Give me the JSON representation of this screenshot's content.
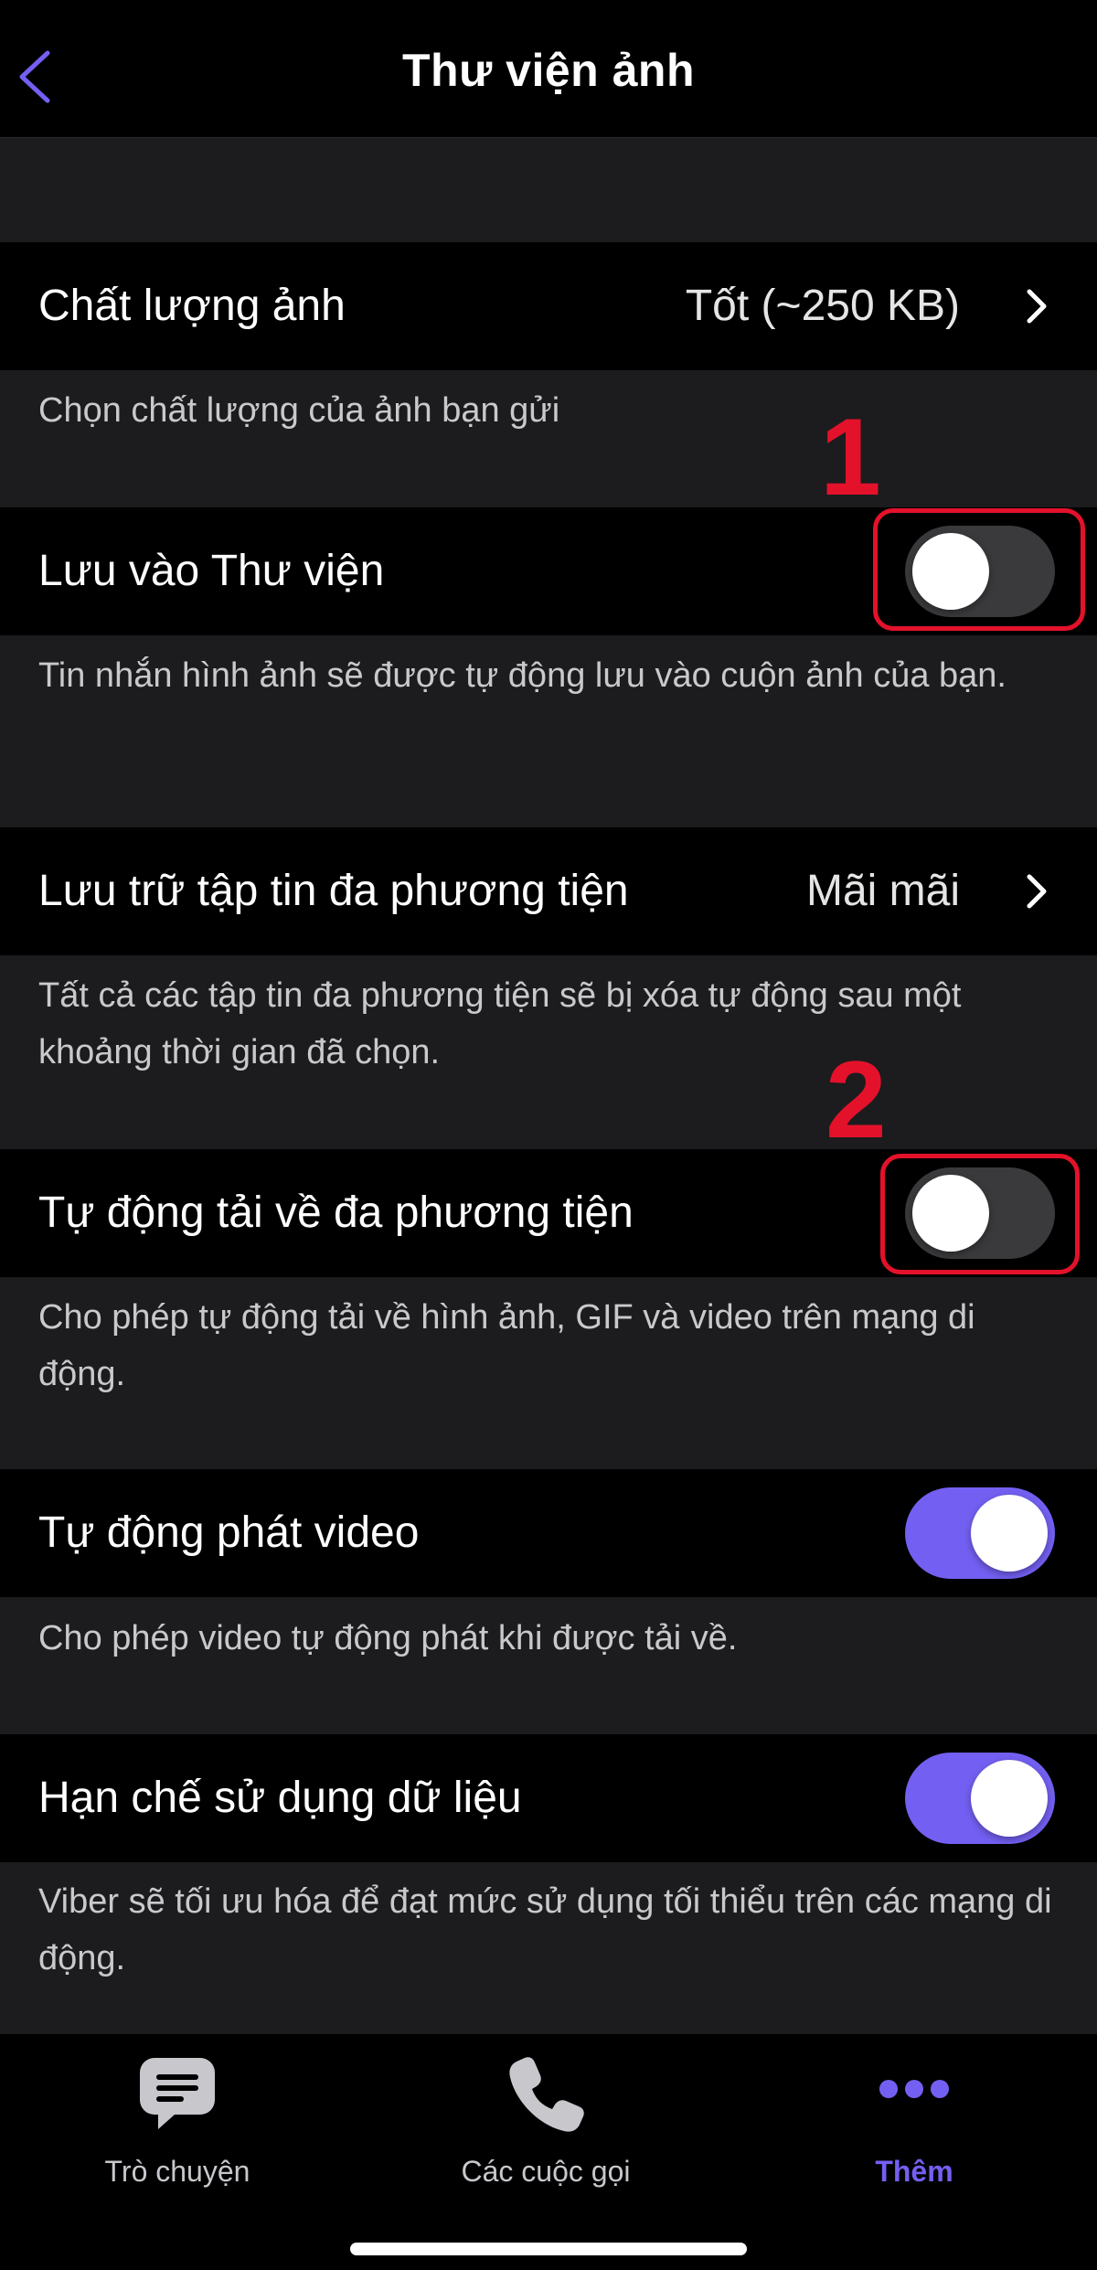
{
  "header": {
    "title": "Thư viện ảnh",
    "back_icon": "chevron-left-icon"
  },
  "settings": [
    {
      "label": "Chất lượng ảnh",
      "value": "Tốt (~250 KB)",
      "description": "Chọn chất lượng của ảnh bạn gửi"
    },
    {
      "label": "Lưu vào Thư viện",
      "toggle": false,
      "description": "Tin nhắn hình ảnh sẽ được tự động lưu vào cuộn ảnh của bạn."
    },
    {
      "label": "Lưu trữ tập tin đa phương tiện",
      "value": "Mãi mãi",
      "description": "Tất cả các tập tin đa phương tiện sẽ bị xóa tự động sau một khoảng thời gian đã chọn."
    },
    {
      "label": "Tự động tải về đa phương tiện",
      "toggle": false,
      "description": "Cho phép tự động tải về hình ảnh, GIF và video trên mạng di động."
    },
    {
      "label": "Tự động phát video",
      "toggle": true,
      "description": "Cho phép video tự động phát khi được tải về."
    },
    {
      "label": "Hạn chế sử dụng dữ liệu",
      "toggle": true,
      "description": "Viber sẽ tối ưu hóa để đạt mức sử dụng tối thiểu trên các mạng di động."
    }
  ],
  "annotations": {
    "first": "1",
    "second": "2"
  },
  "tabbar": {
    "tabs": [
      {
        "label": "Trò chuyện",
        "icon": "chat-bubble-icon",
        "active": false
      },
      {
        "label": "Các cuộc gọi",
        "icon": "phone-icon",
        "active": false
      },
      {
        "label": "Thêm",
        "icon": "more-dots-icon",
        "active": true
      }
    ]
  },
  "colors": {
    "accent": "#7360f2",
    "annotation": "#e4112b",
    "background": "#1c1c1e",
    "row": "#000000"
  }
}
